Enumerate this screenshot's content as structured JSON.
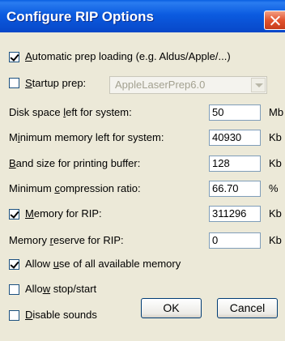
{
  "window": {
    "title": "Configure RIP Options"
  },
  "options": {
    "auto_prep": {
      "label_ul": "A",
      "label_rest": "utomatic prep loading (e.g. Aldus/Apple/...)",
      "checked": true
    },
    "startup_prep": {
      "label_ul": "S",
      "label_rest": "tartup prep:",
      "checked": false,
      "value": "AppleLaserPrep6.0"
    },
    "disk_space": {
      "label_pre": "Disk space ",
      "label_ul": "l",
      "label_post": "eft for system:",
      "value": "50",
      "unit": "Mb"
    },
    "min_memory": {
      "label_pre": "M",
      "label_ul": "i",
      "label_post": "nimum memory left for system:",
      "value": "40930",
      "unit": "Kb"
    },
    "band_size": {
      "label_pre": "",
      "label_ul": "B",
      "label_post": "and size for printing buffer:",
      "value": "128",
      "unit": "Kb"
    },
    "compression": {
      "label_pre": "Minimum ",
      "label_ul": "c",
      "label_post": "ompression ratio:",
      "value": "66.70",
      "unit": "%"
    },
    "memory_rip": {
      "label_ul": "M",
      "label_rest": "emory for RIP:",
      "checked": true,
      "value": "311296",
      "unit": "Kb"
    },
    "memory_reserve": {
      "label_pre": "Memory ",
      "label_ul": "r",
      "label_post": "eserve for RIP:",
      "value": "0",
      "unit": "Kb"
    },
    "allow_all_memory": {
      "label_pre": "Allow ",
      "label_ul": "u",
      "label_post": "se of all available memory",
      "checked": true
    },
    "allow_stop": {
      "label_pre": "Allo",
      "label_ul": "w",
      "label_post": " stop/start",
      "checked": false
    },
    "disable_sounds": {
      "label_ul": "D",
      "label_rest": "isable sounds",
      "checked": false
    }
  },
  "buttons": {
    "ok": "OK",
    "cancel": "Cancel"
  }
}
